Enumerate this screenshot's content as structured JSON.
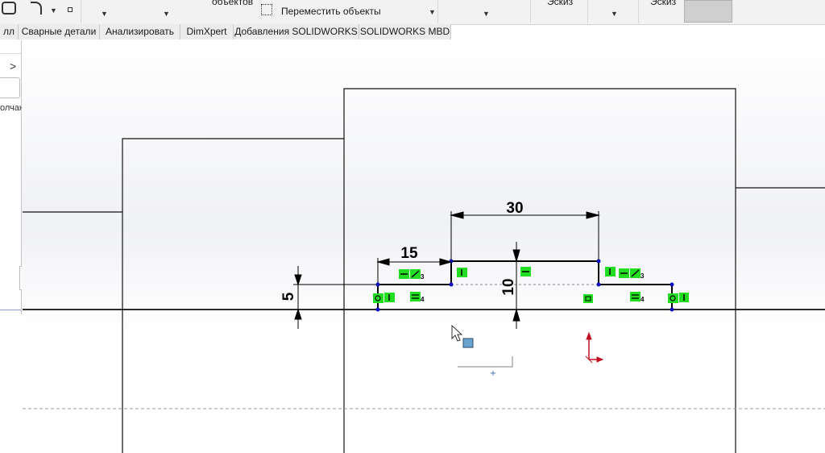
{
  "ribbon": {
    "objects_label": "объектов",
    "move_objects_label": "Переместить объекты",
    "sketch_label_1": "Эскиз",
    "sketch_label_2": "Эскиз"
  },
  "tabs": [
    {
      "label": "лл"
    },
    {
      "label": "Сварные детали"
    },
    {
      "label": "Анализировать"
    },
    {
      "label": "DimXpert"
    },
    {
      "label": "Добавления SOLIDWORKS"
    },
    {
      "label": "SOLIDWORKS MBD"
    }
  ],
  "left_panel": {
    "expand_label": ">",
    "truncated_text": "олчан"
  },
  "sketch": {
    "dimensions": [
      {
        "name": "width-top",
        "value": "30"
      },
      {
        "name": "offset-left",
        "value": "15"
      },
      {
        "name": "height-step",
        "value": "10"
      },
      {
        "name": "height-small",
        "value": "5"
      }
    ],
    "relation_subscripts": [
      "3",
      "4",
      "3",
      "4"
    ]
  },
  "colors": {
    "sketch_line": "#000000",
    "sketch_point": "#1010c0",
    "relation_bg": "#22dd22",
    "origin": "#c01020",
    "edge": "#111111"
  },
  "icons": [
    "zoom-to-fit-icon",
    "zoom-area-icon",
    "previous-view-icon",
    "section-view-icon",
    "dynamic-annotation-icon",
    "view-orientation-icon",
    "display-style-icon",
    "hide-show-icon",
    "edit-appearance-icon",
    "apply-scene-icon",
    "view-settings-icon"
  ]
}
